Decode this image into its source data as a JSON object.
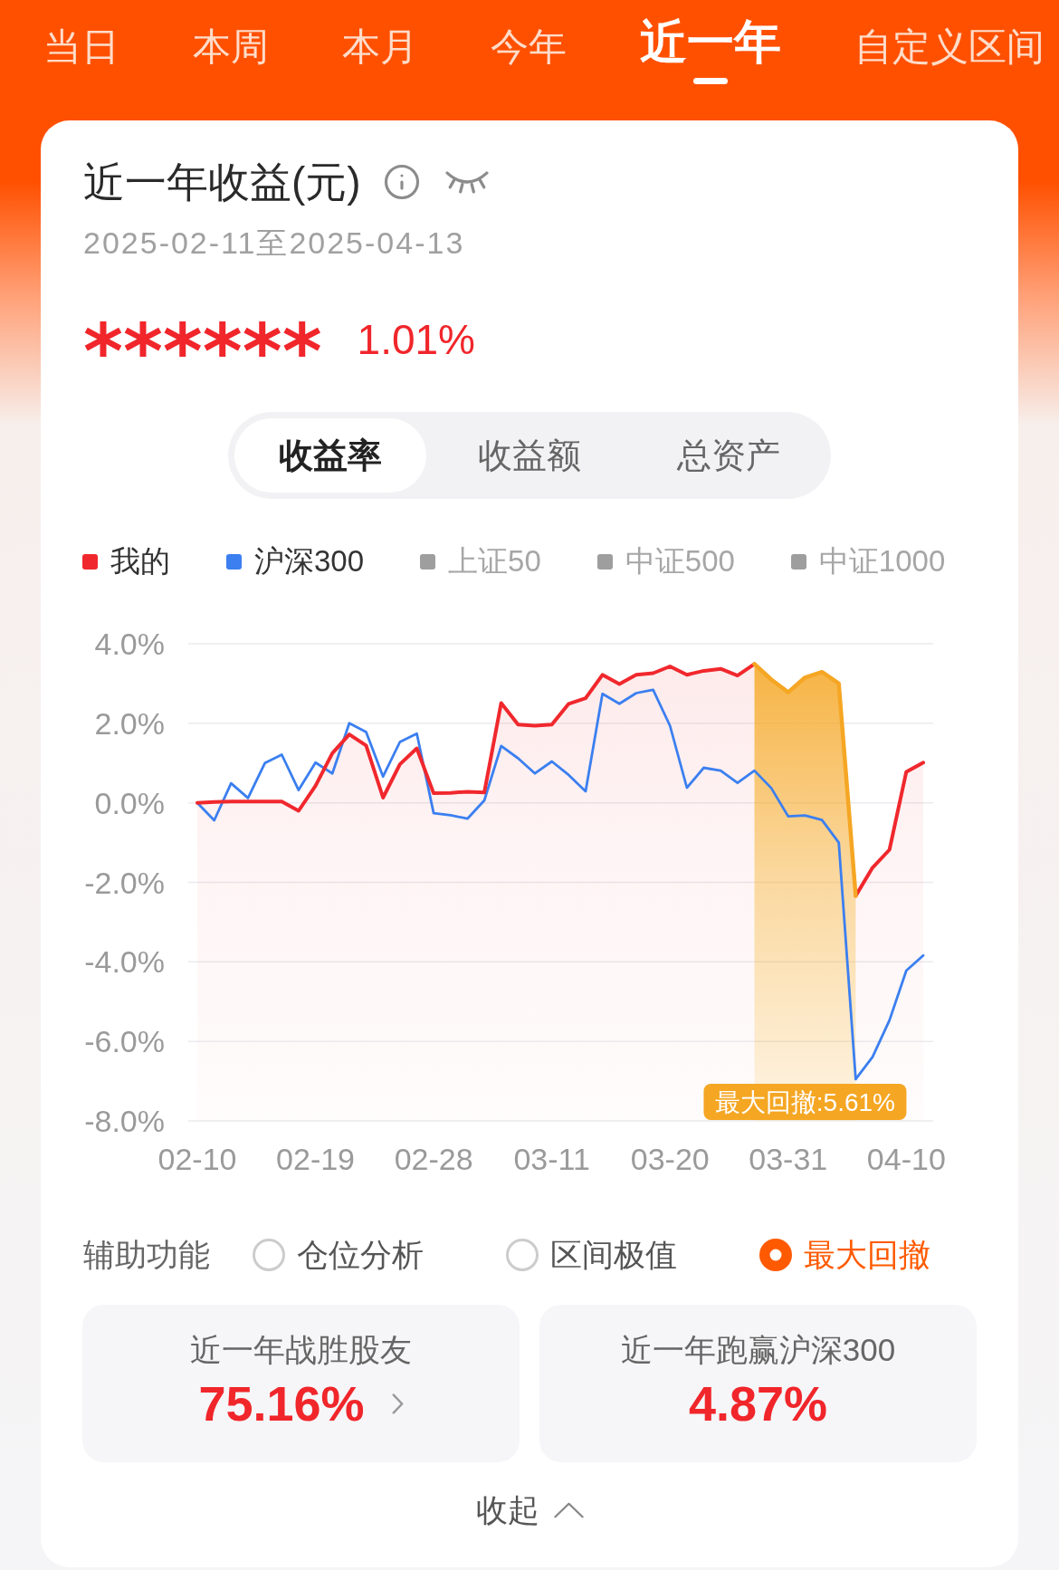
{
  "period_tabs": [
    {
      "label": "当日",
      "selected": false
    },
    {
      "label": "本周",
      "selected": false
    },
    {
      "label": "本月",
      "selected": false
    },
    {
      "label": "今年",
      "selected": false
    },
    {
      "label": "近一年",
      "selected": true
    },
    {
      "label": "自定义区间",
      "selected": false
    }
  ],
  "summary": {
    "title": "近一年收益(元)",
    "date_range": "2025-02-11至2025-04-13",
    "amount": "******",
    "rate": "1.01%"
  },
  "view_tabs": [
    {
      "label": "收益率",
      "selected": true
    },
    {
      "label": "收益额",
      "selected": false
    },
    {
      "label": "总资产",
      "selected": false
    }
  ],
  "chart": {
    "legend_items": [
      {
        "selected": true
      },
      {
        "selected": true
      },
      {
        "label": "上证50",
        "selected": false,
        "color": "#9e9e9e"
      },
      {
        "label": "中证500",
        "selected": false,
        "color": "#9e9e9e"
      },
      {
        "label": "中证1000",
        "selected": false,
        "color": "#9e9e9e"
      }
    ],
    "chart_data": {
      "type": "line",
      "legend": "top",
      "categories": [
        "02-10",
        null,
        null,
        null,
        null,
        null,
        null,
        "02-19",
        null,
        null,
        null,
        null,
        null,
        null,
        "02-28",
        null,
        null,
        null,
        null,
        null,
        null,
        "03-11",
        null,
        null,
        null,
        null,
        null,
        null,
        "03-20",
        null,
        null,
        null,
        null,
        null,
        null,
        "03-31",
        null,
        null,
        null,
        null,
        null,
        null,
        "04-10",
        null
      ],
      "series": [
        {
          "name": "我的",
          "color": "#f0282d",
          "values": [
            0,
            0.02,
            0.03,
            0.03,
            0.03,
            0.03,
            -0.2,
            0.43,
            1.25,
            1.72,
            1.44,
            0.13,
            0.97,
            1.37,
            0.24,
            0.25,
            0.28,
            0.26,
            2.51,
            1.97,
            1.94,
            1.97,
            2.49,
            2.63,
            3.22,
            2.99,
            3.22,
            3.26,
            3.43,
            3.22,
            3.32,
            3.37,
            3.2,
            3.49,
            null,
            null,
            null,
            null,
            null,
            -2.34,
            -1.63,
            -1.18,
            0.78,
            1.01
          ]
        },
        {
          "name": "沪深300",
          "color": "#3b7ff0",
          "values": [
            0,
            -0.44,
            0.49,
            0.12,
            1.0,
            1.21,
            0.32,
            1.01,
            0.74,
            2.0,
            1.78,
            0.66,
            1.53,
            1.74,
            -0.26,
            -0.31,
            -0.4,
            0.06,
            1.43,
            1.12,
            0.74,
            1.04,
            0.7,
            0.29,
            2.74,
            2.49,
            2.76,
            2.84,
            1.94,
            0.38,
            0.88,
            0.81,
            0.5,
            0.81,
            0.37,
            -0.34,
            -0.32,
            -0.43,
            -1.0,
            -6.95,
            -6.39,
            -5.47,
            -4.22,
            -3.84
          ]
        },
        {
          "name": "最大回撤:5.61%",
          "color": "#f5a623",
          "values": [
            null,
            null,
            null,
            null,
            null,
            null,
            null,
            null,
            null,
            null,
            null,
            null,
            null,
            null,
            null,
            null,
            null,
            null,
            null,
            null,
            null,
            null,
            null,
            null,
            null,
            null,
            null,
            null,
            null,
            null,
            null,
            null,
            null,
            3.49,
            3.1,
            2.78,
            3.15,
            3.29,
            3.0,
            -2.34,
            null,
            null,
            null,
            null
          ]
        }
      ],
      "ylim": [
        -8,
        4
      ],
      "yticks": [
        {
          "value": 4,
          "label": "4.0%"
        },
        {
          "value": 2,
          "label": "2.0%"
        },
        {
          "value": 0,
          "label": "0.0%"
        },
        {
          "value": -2,
          "label": "-2.0%"
        },
        {
          "value": -4,
          "label": "-4.0%"
        },
        {
          "value": -6,
          "label": "-6.0%"
        },
        {
          "value": -8,
          "label": "-8.0%"
        }
      ],
      "grid": true
    }
  },
  "assist": {
    "label": "辅助功能",
    "options": [
      {
        "label": "仓位分析",
        "selected": false
      },
      {
        "label": "区间极值",
        "selected": false
      },
      {
        "label": "最大回撤",
        "selected": true
      }
    ]
  },
  "stats": [
    {
      "label": "近一年战胜股友",
      "value": "75.16%",
      "link": true
    },
    {
      "label": "近一年跑赢沪深300",
      "value": "4.87%",
      "link": false
    }
  ],
  "collapse": {
    "label": "收起"
  }
}
